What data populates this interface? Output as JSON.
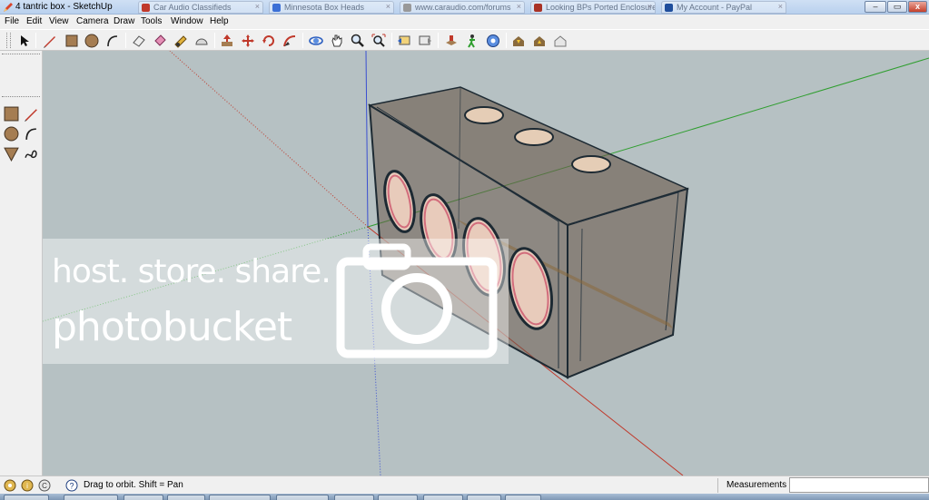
{
  "window": {
    "title": "4 tantric box - SketchUp",
    "background_tabs": [
      "Car Audio Classifieds",
      "Minnesota Box Heads",
      "www.caraudio.com/forums",
      "Looking BPs Ported Enclosures",
      "My Account - PayPal"
    ],
    "minimize_label": "–",
    "restore_label": "▭",
    "close_label": "x"
  },
  "menubar": {
    "items": [
      "File",
      "Edit",
      "View",
      "Camera",
      "Draw",
      "Tools",
      "Window",
      "Help"
    ]
  },
  "toolbar": {
    "tools": [
      "select-icon",
      "pencil-line-icon",
      "rectangle-icon",
      "circle-icon",
      "arc-icon",
      "eraser-icon",
      "paint-bucket-icon",
      "eraser-pink-icon",
      "tape-measure-icon",
      "protractor-icon",
      "push-pull-icon",
      "move-icon",
      "rotate-icon",
      "follow-me-icon",
      "orbit-icon",
      "pan-icon",
      "zoom-icon",
      "zoom-extents-icon",
      "previous-view-icon",
      "next-view-icon",
      "top-view-icon",
      "walk-icon",
      "look-around-icon",
      "warehouse-get-icon",
      "warehouse-share-icon",
      "component-share-icon"
    ]
  },
  "left_palette": {
    "tools": [
      "rectangle-icon",
      "line-icon",
      "circle-icon",
      "arc-icon",
      "polygon-icon",
      "freehand-icon"
    ]
  },
  "watermark": {
    "line1": "host. store. share.",
    "line2": "photobucket"
  },
  "statusbar": {
    "hint": "Drag to orbit.  Shift = Pan",
    "measurements_label": "Measurements",
    "measurements_value": ""
  },
  "colors": {
    "viewport_bg": "#b6c1c3",
    "box_tint": "#6b5a4c",
    "axis_red": "#c0392b",
    "axis_green": "#2f9e2f",
    "axis_blue": "#3a4fd1"
  }
}
